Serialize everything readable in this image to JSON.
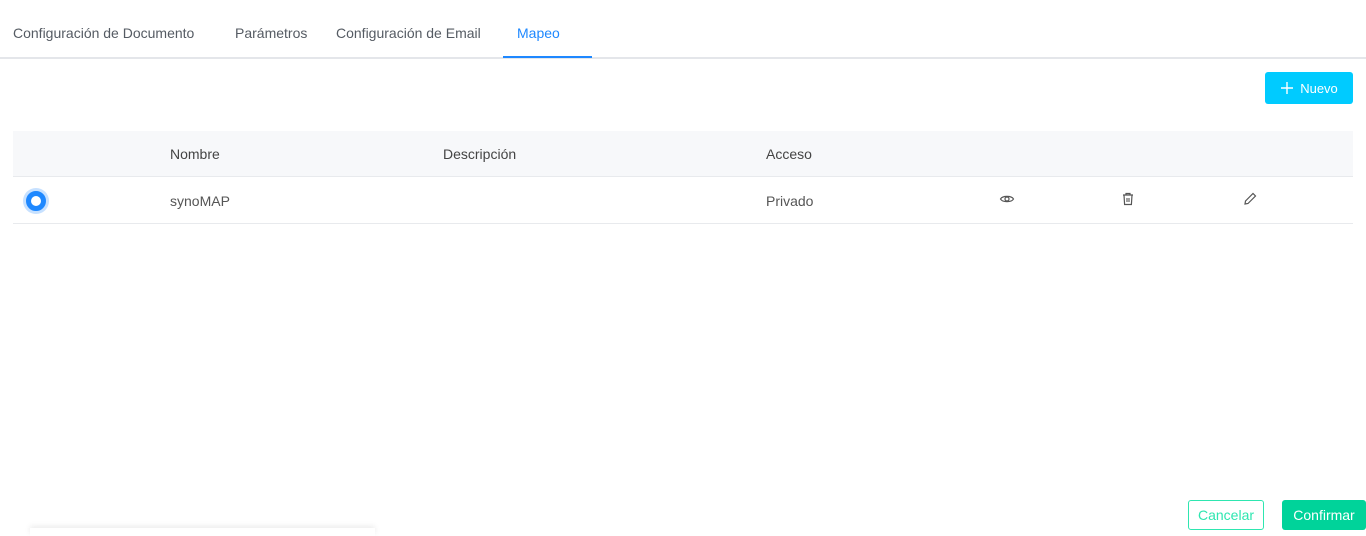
{
  "tabs": [
    {
      "label": "Configuración de Documento"
    },
    {
      "label": "Parámetros"
    },
    {
      "label": "Configuración de Email"
    },
    {
      "label": "Mapeo"
    }
  ],
  "toolbar": {
    "new_label": "Nuevo"
  },
  "table": {
    "headers": [
      "Nombre",
      "Descripción",
      "Acceso"
    ],
    "rows": [
      {
        "nombre": "synoMAP",
        "descripcion": "",
        "acceso": "Privado",
        "selected": true
      }
    ]
  },
  "footer": {
    "cancel_label": "Cancelar",
    "confirm_label": "Confirmar"
  }
}
